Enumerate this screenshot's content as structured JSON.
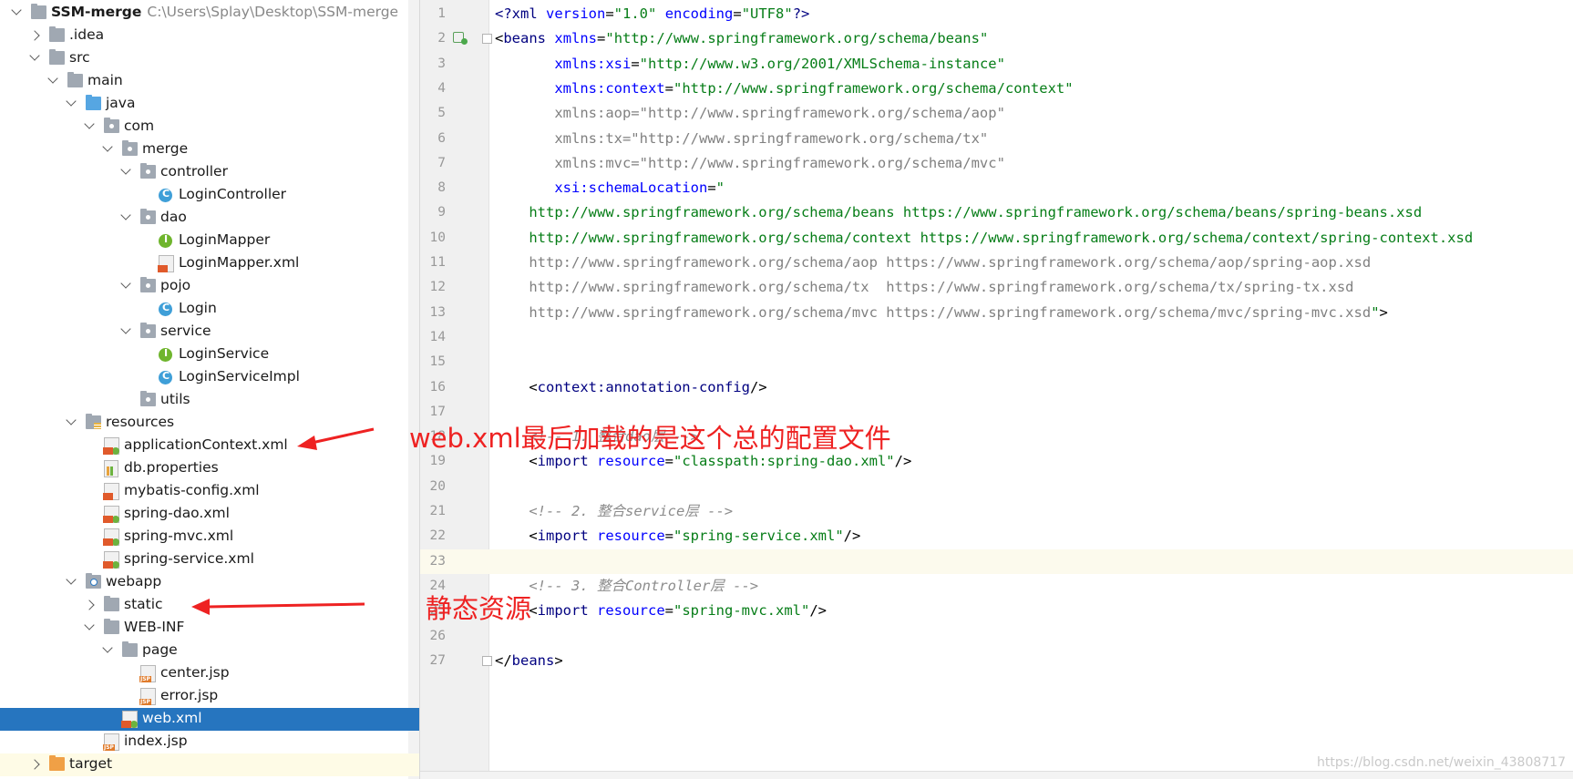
{
  "tree": {
    "items": [
      {
        "label": "SSM-merge",
        "path": "C:\\Users\\Splay\\Desktop\\SSM-merge",
        "icon": "project-folder-icon",
        "expanded": true
      },
      {
        "label": ".idea",
        "icon": "folder-icon",
        "expanded": false
      },
      {
        "label": "src",
        "icon": "folder-icon",
        "expanded": true
      },
      {
        "label": "main",
        "icon": "folder-icon",
        "expanded": true
      },
      {
        "label": "java",
        "icon": "source-folder-icon",
        "expanded": true
      },
      {
        "label": "com",
        "icon": "package-icon",
        "expanded": true
      },
      {
        "label": "merge",
        "icon": "package-icon",
        "expanded": true
      },
      {
        "label": "controller",
        "icon": "package-icon",
        "expanded": true
      },
      {
        "label": "LoginController",
        "icon": "class-icon"
      },
      {
        "label": "dao",
        "icon": "package-icon",
        "expanded": true
      },
      {
        "label": "LoginMapper",
        "icon": "interface-icon"
      },
      {
        "label": "LoginMapper.xml",
        "icon": "xml-file-icon"
      },
      {
        "label": "pojo",
        "icon": "package-icon",
        "expanded": true
      },
      {
        "label": "Login",
        "icon": "class-icon"
      },
      {
        "label": "service",
        "icon": "package-icon",
        "expanded": true
      },
      {
        "label": "LoginService",
        "icon": "interface-icon"
      },
      {
        "label": "LoginServiceImpl",
        "icon": "class-icon"
      },
      {
        "label": "utils",
        "icon": "package-icon"
      },
      {
        "label": "resources",
        "icon": "resources-folder-icon",
        "expanded": true
      },
      {
        "label": "applicationContext.xml",
        "icon": "spring-xml-file-icon"
      },
      {
        "label": "db.properties",
        "icon": "properties-file-icon"
      },
      {
        "label": "mybatis-config.xml",
        "icon": "xml-file-icon"
      },
      {
        "label": "spring-dao.xml",
        "icon": "spring-xml-file-icon"
      },
      {
        "label": "spring-mvc.xml",
        "icon": "spring-xml-file-icon"
      },
      {
        "label": "spring-service.xml",
        "icon": "spring-xml-file-icon"
      },
      {
        "label": "webapp",
        "icon": "web-folder-icon",
        "expanded": true
      },
      {
        "label": "static",
        "icon": "folder-icon",
        "expanded": false
      },
      {
        "label": "WEB-INF",
        "icon": "folder-icon",
        "expanded": true
      },
      {
        "label": "page",
        "icon": "folder-icon",
        "expanded": true
      },
      {
        "label": "center.jsp",
        "icon": "jsp-file-icon"
      },
      {
        "label": "error.jsp",
        "icon": "jsp-file-icon"
      },
      {
        "label": "web.xml",
        "icon": "web-xml-file-icon",
        "selected": true
      },
      {
        "label": "index.jsp",
        "icon": "jsp-file-icon"
      },
      {
        "label": "target",
        "icon": "excluded-folder-icon",
        "expanded": false
      }
    ]
  },
  "editor": {
    "lines": [
      {
        "n": "1",
        "html": "<span class='k'>&lt;?xml </span><span class='a'>version</span>=<span class='s'>\"1.0\"</span> <span class='a'>encoding</span>=<span class='s'>\"UTF8\"</span><span class='k'>?&gt;</span>"
      },
      {
        "n": "2",
        "html": "&lt;<span class='k'>beans</span> <span class='a'>xmlns</span>=<span class='s'>\"http://www.springframework.org/schema/beans\"</span>"
      },
      {
        "n": "3",
        "html": "       <span class='a'>xmlns:xsi</span>=<span class='s'>\"http://www.w3.org/2001/XMLSchema-instance\"</span>"
      },
      {
        "n": "4",
        "html": "       <span class='a'>xmlns:context</span>=<span class='s'>\"http://www.springframework.org/schema/context\"</span>"
      },
      {
        "n": "5",
        "html": "<span class='g'>       xmlns:aop=\"http://www.springframework.org/schema/aop\"</span>"
      },
      {
        "n": "6",
        "html": "<span class='g'>       xmlns:tx=\"http://www.springframework.org/schema/tx\"</span>"
      },
      {
        "n": "7",
        "html": "<span class='g'>       xmlns:mvc=\"http://www.springframework.org/schema/mvc\"</span>"
      },
      {
        "n": "8",
        "html": "       <span class='a'>xsi:schemaLocation</span>=<span class='s'>\"</span>"
      },
      {
        "n": "9",
        "html": "    <span class='s'>http://www.springframework.org/schema/beans https://www.springframework.org/schema/beans/spring-beans.xsd</span>"
      },
      {
        "n": "10",
        "html": "    <span class='s'>http://www.springframework.org/schema/context https://www.springframework.org/schema/context/spring-context.xsd</span>"
      },
      {
        "n": "11",
        "html": "<span class='g'>    http://www.springframework.org/schema/aop https://www.springframework.org/schema/aop/spring-aop.xsd</span>"
      },
      {
        "n": "12",
        "html": "<span class='g'>    http://www.springframework.org/schema/tx  https://www.springframework.org/schema/tx/spring-tx.xsd</span>"
      },
      {
        "n": "13",
        "html": "<span class='g'>    http://www.springframework.org/schema/mvc https://www.springframework.org/schema/mvc/spring-mvc.xsd</span><span class='s'>\"</span>&gt;"
      },
      {
        "n": "14",
        "html": ""
      },
      {
        "n": "15",
        "html": ""
      },
      {
        "n": "16",
        "html": "    &lt;<span class='k'>context:annotation-config</span>/&gt;"
      },
      {
        "n": "17",
        "html": ""
      },
      {
        "n": "18",
        "html": "    <span class='c'>&lt;!-- 1. 整合dao层 --&gt;</span>"
      },
      {
        "n": "19",
        "html": "    &lt;<span class='k'>import</span> <span class='a'>resource</span>=<span class='s'>\"classpath:spring-dao.xml\"</span>/&gt;"
      },
      {
        "n": "20",
        "html": ""
      },
      {
        "n": "21",
        "html": "    <span class='c'>&lt;!-- 2. 整合service层 --&gt;</span>"
      },
      {
        "n": "22",
        "html": "    &lt;<span class='k'>import</span> <span class='a'>resource</span>=<span class='s'>\"spring-service.xml\"</span>/&gt;"
      },
      {
        "n": "23",
        "html": "",
        "current": true
      },
      {
        "n": "24",
        "html": "    <span class='c'>&lt;!-- 3. 整合Controller层 --&gt;</span>"
      },
      {
        "n": "25",
        "html": "    &lt;<span class='k'>import</span> <span class='a'>resource</span>=<span class='s'>\"spring-mvc.xml\"</span>/&gt;"
      },
      {
        "n": "26",
        "html": ""
      },
      {
        "n": "27",
        "html": "&lt;/<span class='k'>beans</span>&gt;"
      }
    ]
  },
  "annotations": {
    "webxml_note": "web.xml最后加载的是这个总的配置文件",
    "static_note": "静态资源"
  },
  "watermark": "https://blog.csdn.net/weixin_43808717",
  "colors": {
    "annotation": "#ee2222",
    "selection": "#2675bf",
    "current_line": "#fcfaed"
  }
}
